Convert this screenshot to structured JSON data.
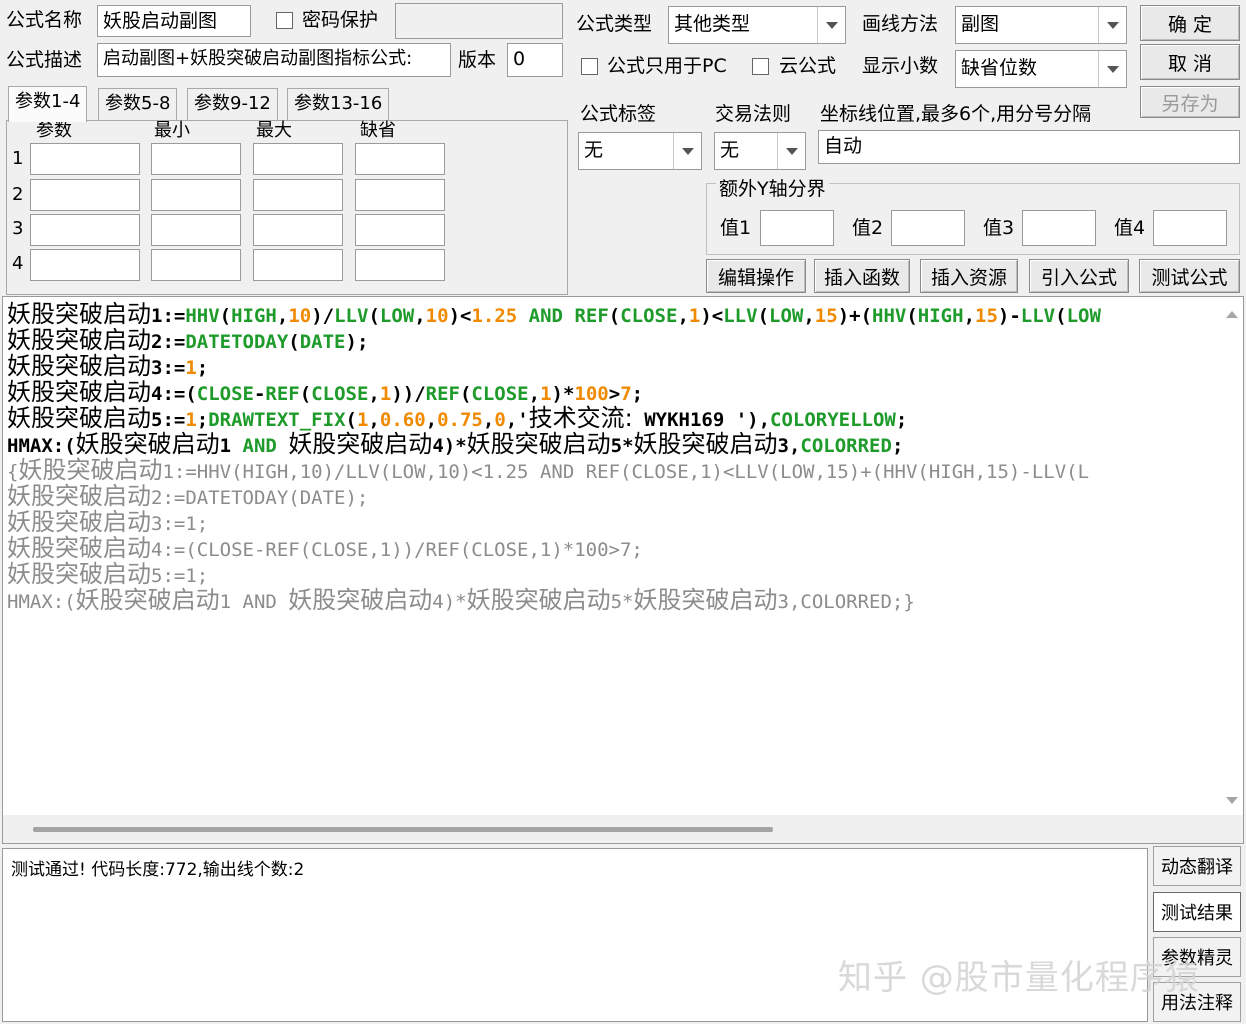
{
  "top": {
    "name_label": "公式名称",
    "name_value": "妖股启动副图",
    "password_label": "密码保护",
    "desc_label": "公式描述",
    "desc_value": "启动副图+妖股突破启动副图指标公式:",
    "version_label": "版本",
    "version_value": "0",
    "type_label": "公式类型",
    "type_value": "其他类型",
    "draw_label": "画线方法",
    "draw_value": "副图",
    "pc_only_label": "公式只用于PC",
    "cloud_label": "云公式",
    "decimals_label": "显示小数",
    "decimals_value": "缺省位数",
    "tag_label": "公式标签",
    "tag_value": "无",
    "trade_label": "交易法则",
    "trade_value": "无",
    "axis_label": "坐标线位置,最多6个,用分号分隔",
    "axis_value": "自动"
  },
  "buttons": {
    "ok": "确  定",
    "cancel": "取  消",
    "save_as": "另存为",
    "edit": "编辑操作",
    "insert_func": "插入函数",
    "insert_res": "插入资源",
    "import": "引入公式",
    "test": "测试公式"
  },
  "tabs": [
    "参数1-4",
    "参数5-8",
    "参数9-12",
    "参数13-16"
  ],
  "params": {
    "headers": [
      "参数",
      "最小",
      "最大",
      "缺省"
    ],
    "rows": [
      "1",
      "2",
      "3",
      "4"
    ]
  },
  "yaxis": {
    "title": "额外Y轴分界",
    "labels": [
      "值1",
      "值2",
      "值3",
      "值4"
    ]
  },
  "code": {
    "line1": [
      {
        "t": "妖股突破启动",
        "k": "cn"
      },
      {
        "t": "1:=",
        "k": "d"
      },
      {
        "t": "HHV",
        "k": "f"
      },
      {
        "t": "(",
        "k": "d"
      },
      {
        "t": "HIGH",
        "k": "f"
      },
      {
        "t": ",",
        "k": "d"
      },
      {
        "t": "10",
        "k": "n"
      },
      {
        "t": ")/",
        "k": "d"
      },
      {
        "t": "LLV",
        "k": "f"
      },
      {
        "t": "(",
        "k": "d"
      },
      {
        "t": "LOW",
        "k": "f"
      },
      {
        "t": ",",
        "k": "d"
      },
      {
        "t": "10",
        "k": "n"
      },
      {
        "t": ")<",
        "k": "d"
      },
      {
        "t": "1.25",
        "k": "n"
      },
      {
        "t": " ",
        "k": "d"
      },
      {
        "t": "AND",
        "k": "f"
      },
      {
        "t": " ",
        "k": "d"
      },
      {
        "t": "REF",
        "k": "f"
      },
      {
        "t": "(",
        "k": "d"
      },
      {
        "t": "CLOSE",
        "k": "f"
      },
      {
        "t": ",",
        "k": "d"
      },
      {
        "t": "1",
        "k": "n"
      },
      {
        "t": ")<",
        "k": "d"
      },
      {
        "t": "LLV",
        "k": "f"
      },
      {
        "t": "(",
        "k": "d"
      },
      {
        "t": "LOW",
        "k": "f"
      },
      {
        "t": ",",
        "k": "d"
      },
      {
        "t": "15",
        "k": "n"
      },
      {
        "t": ")+(",
        "k": "d"
      },
      {
        "t": "HHV",
        "k": "f"
      },
      {
        "t": "(",
        "k": "d"
      },
      {
        "t": "HIGH",
        "k": "f"
      },
      {
        "t": ",",
        "k": "d"
      },
      {
        "t": "15",
        "k": "n"
      },
      {
        "t": ")-",
        "k": "d"
      },
      {
        "t": "LLV",
        "k": "f"
      },
      {
        "t": "(",
        "k": "d"
      },
      {
        "t": "LOW",
        "k": "f"
      }
    ],
    "line2": [
      {
        "t": "妖股突破启动",
        "k": "cn"
      },
      {
        "t": "2:=",
        "k": "d"
      },
      {
        "t": "DATETODAY",
        "k": "f"
      },
      {
        "t": "(",
        "k": "d"
      },
      {
        "t": "DATE",
        "k": "f"
      },
      {
        "t": ");",
        "k": "d"
      }
    ],
    "line3": [
      {
        "t": "妖股突破启动",
        "k": "cn"
      },
      {
        "t": "3:=",
        "k": "d"
      },
      {
        "t": "1",
        "k": "n"
      },
      {
        "t": ";",
        "k": "d"
      }
    ],
    "line4": [
      {
        "t": "妖股突破启动",
        "k": "cn"
      },
      {
        "t": "4:=(",
        "k": "d"
      },
      {
        "t": "CLOSE",
        "k": "f"
      },
      {
        "t": "-",
        "k": "d"
      },
      {
        "t": "REF",
        "k": "f"
      },
      {
        "t": "(",
        "k": "d"
      },
      {
        "t": "CLOSE",
        "k": "f"
      },
      {
        "t": ",",
        "k": "d"
      },
      {
        "t": "1",
        "k": "n"
      },
      {
        "t": "))/",
        "k": "d"
      },
      {
        "t": "REF",
        "k": "f"
      },
      {
        "t": "(",
        "k": "d"
      },
      {
        "t": "CLOSE",
        "k": "f"
      },
      {
        "t": ",",
        "k": "d"
      },
      {
        "t": "1",
        "k": "n"
      },
      {
        "t": ")*",
        "k": "d"
      },
      {
        "t": "100",
        "k": "n"
      },
      {
        "t": ">",
        "k": "d"
      },
      {
        "t": "7",
        "k": "n"
      },
      {
        "t": ";",
        "k": "d"
      }
    ],
    "line5": [
      {
        "t": "妖股突破启动",
        "k": "cn"
      },
      {
        "t": "5:=",
        "k": "d"
      },
      {
        "t": "1",
        "k": "n"
      },
      {
        "t": ";",
        "k": "d"
      },
      {
        "t": "DRAWTEXT_FIX",
        "k": "f"
      },
      {
        "t": "(",
        "k": "d"
      },
      {
        "t": "1",
        "k": "n"
      },
      {
        "t": ",",
        "k": "d"
      },
      {
        "t": "0.60",
        "k": "n"
      },
      {
        "t": ",",
        "k": "d"
      },
      {
        "t": "0.75",
        "k": "n"
      },
      {
        "t": ",",
        "k": "d"
      },
      {
        "t": "0",
        "k": "n"
      },
      {
        "t": ",'",
        "k": "d"
      },
      {
        "t": "技术交流:",
        "k": "cn"
      },
      {
        "t": " WYKH169 ')",
        "k": "d"
      },
      {
        "t": ",",
        "k": "d"
      },
      {
        "t": "COLORYELLOW",
        "k": "f"
      },
      {
        "t": ";",
        "k": "d"
      }
    ],
    "line6": [
      {
        "t": "HMAX:(",
        "k": "d"
      },
      {
        "t": "妖股突破启动",
        "k": "cn"
      },
      {
        "t": "1 ",
        "k": "d"
      },
      {
        "t": "AND",
        "k": "f"
      },
      {
        "t": " ",
        "k": "d"
      },
      {
        "t": "妖股突破启动",
        "k": "cn"
      },
      {
        "t": "4)*",
        "k": "d"
      },
      {
        "t": "妖股突破启动",
        "k": "cn"
      },
      {
        "t": "5*",
        "k": "d"
      },
      {
        "t": "妖股突破启动",
        "k": "cn"
      },
      {
        "t": "3,",
        "k": "d"
      },
      {
        "t": "COLORRED",
        "k": "f"
      },
      {
        "t": ";",
        "k": "d"
      }
    ],
    "line7": [
      {
        "t": "{",
        "k": "g"
      },
      {
        "t": "妖股突破启动",
        "k": "gcn"
      },
      {
        "t": "1:=HHV(HIGH,10)/LLV(LOW,10)<1.25 AND REF(CLOSE,1)<LLV(LOW,15)+(HHV(HIGH,15)-LLV(L",
        "k": "g"
      }
    ],
    "line8": [
      {
        "t": "妖股突破启动",
        "k": "gcn"
      },
      {
        "t": "2:=DATETODAY(DATE);",
        "k": "g"
      }
    ],
    "line9": [
      {
        "t": "妖股突破启动",
        "k": "gcn"
      },
      {
        "t": "3:=1;",
        "k": "g"
      }
    ],
    "line10": [
      {
        "t": "妖股突破启动",
        "k": "gcn"
      },
      {
        "t": "4:=(CLOSE-REF(CLOSE,1))/REF(CLOSE,1)*100>7;",
        "k": "g"
      }
    ],
    "line11": [
      {
        "t": "妖股突破启动",
        "k": "gcn"
      },
      {
        "t": "5:=1;",
        "k": "g"
      }
    ],
    "line12": [
      {
        "t": "HMAX:(",
        "k": "g"
      },
      {
        "t": "妖股突破启动",
        "k": "gcn"
      },
      {
        "t": "1 AND ",
        "k": "g"
      },
      {
        "t": "妖股突破启动",
        "k": "gcn"
      },
      {
        "t": "4)*",
        "k": "g"
      },
      {
        "t": "妖股突破启动",
        "k": "gcn"
      },
      {
        "t": "5*",
        "k": "g"
      },
      {
        "t": "妖股突破启动",
        "k": "gcn"
      },
      {
        "t": "3,COLORRED;}",
        "k": "g"
      }
    ]
  },
  "colors": {
    "func": "#1e9b2a",
    "num": "#f08a00",
    "default": "#000000",
    "comment": "#8c8c8c"
  },
  "output": {
    "text": "测试通过! 代码长度:772,输出线个数:2"
  },
  "side_buttons": [
    "动态翻译",
    "测试结果",
    "参数精灵",
    "用法注释"
  ],
  "watermark": "知乎 @股市量化程序猿"
}
